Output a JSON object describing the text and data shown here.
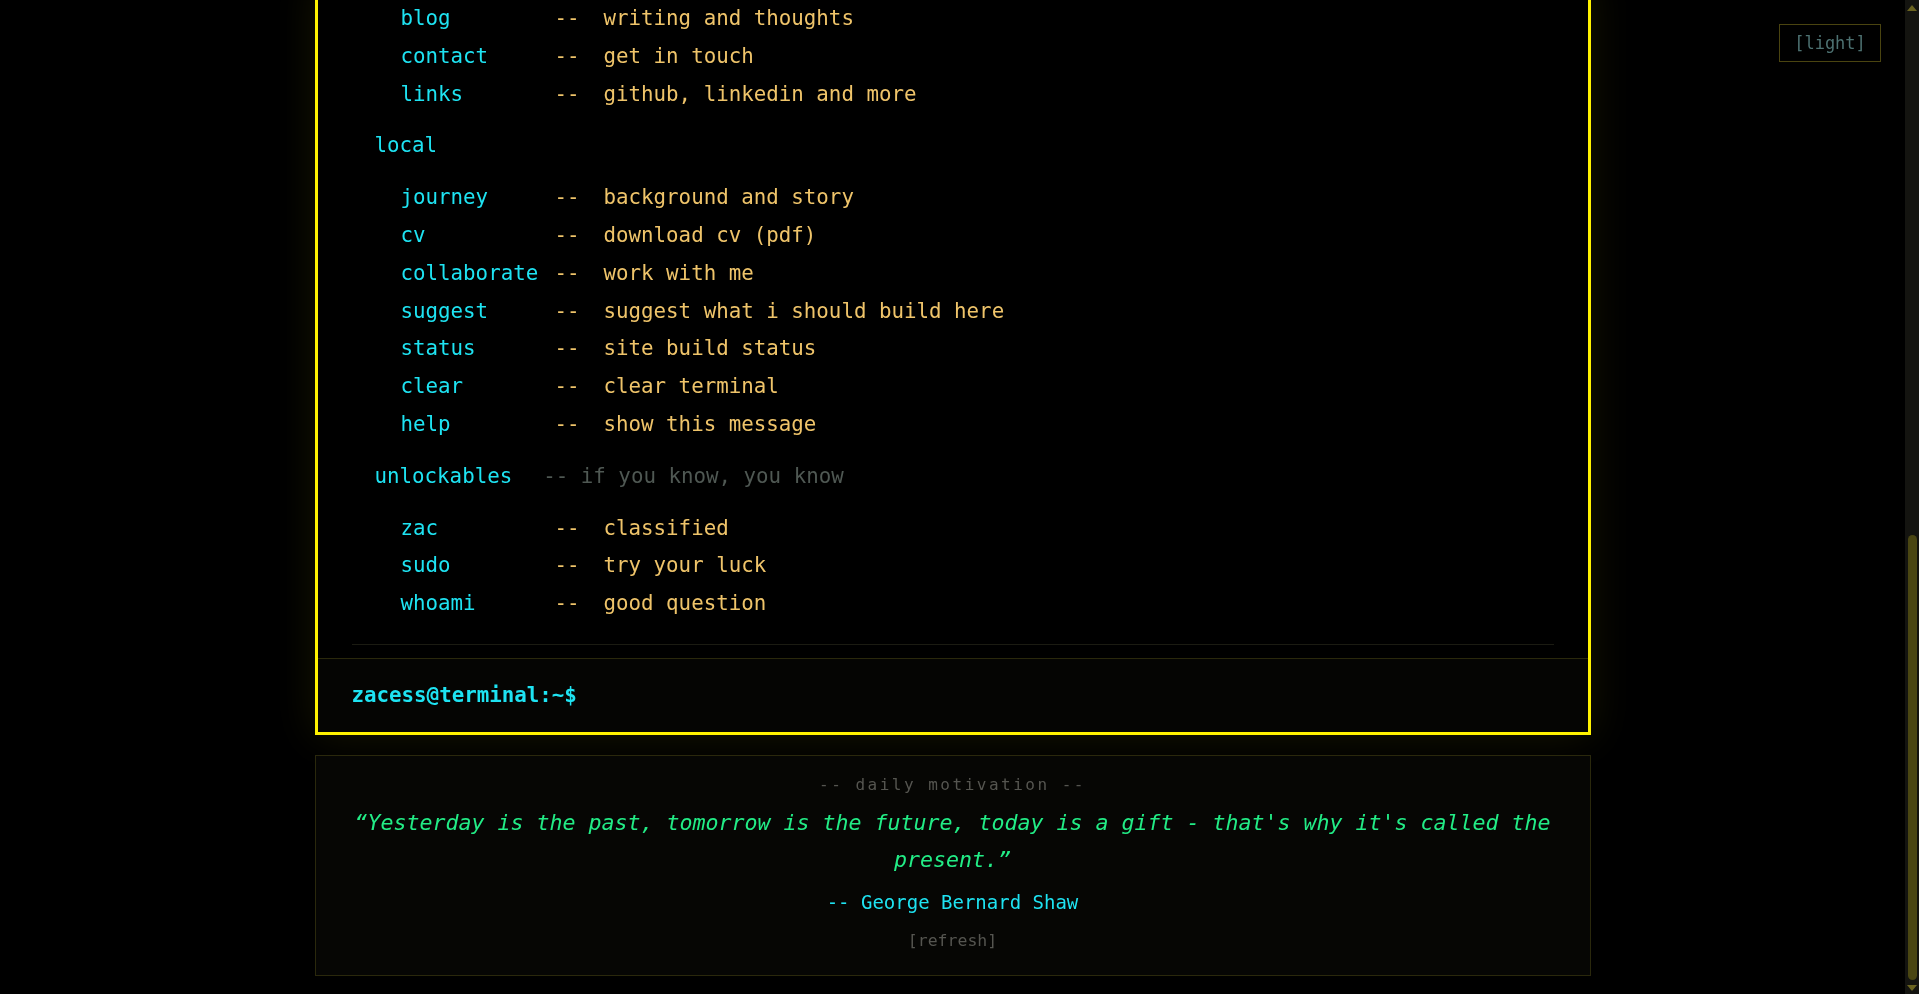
{
  "theme_toggle": {
    "label": "[light]"
  },
  "terminal": {
    "sections": [
      {
        "commands": [
          {
            "name": "blog",
            "separator": "--",
            "description": "writing and thoughts"
          },
          {
            "name": "contact",
            "separator": "--",
            "description": "get in touch"
          },
          {
            "name": "links",
            "separator": "--",
            "description": "github, linkedin and more"
          }
        ]
      },
      {
        "title": "local",
        "commands": [
          {
            "name": "journey",
            "separator": "--",
            "description": "background and story"
          },
          {
            "name": "cv",
            "separator": "--",
            "description": "download cv (pdf)"
          },
          {
            "name": "collaborate",
            "separator": "--",
            "description": "work with me"
          },
          {
            "name": "suggest",
            "separator": "--",
            "description": "suggest what i should build here"
          },
          {
            "name": "status",
            "separator": "--",
            "description": "site build status"
          },
          {
            "name": "clear",
            "separator": "--",
            "description": "clear terminal"
          },
          {
            "name": "help",
            "separator": "--",
            "description": "show this message"
          }
        ]
      },
      {
        "title": "unlockables",
        "note": "-- if you know, you know",
        "commands": [
          {
            "name": "zac",
            "separator": "--",
            "description": "classified"
          },
          {
            "name": "sudo",
            "separator": "--",
            "description": "try your luck"
          },
          {
            "name": "whoami",
            "separator": "--",
            "description": "good question"
          }
        ]
      }
    ],
    "prompt": "zacess@terminal:~$"
  },
  "quote_card": {
    "heading": "-- daily motivation --",
    "text": "“Yesterday is the past, tomorrow is the future, today is a gift - that's why it's called the present.”",
    "author": "-- George Bernard Shaw",
    "refresh": "[refresh]"
  }
}
